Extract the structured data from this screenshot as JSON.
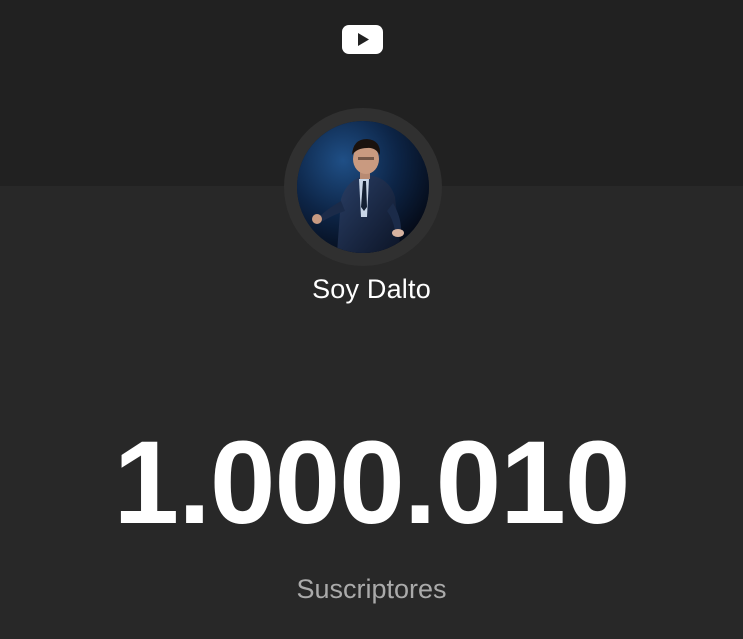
{
  "header": {
    "logo_icon": "youtube-play-icon",
    "logo_color": "#ffffff"
  },
  "channel": {
    "avatar_icon": "channel-avatar",
    "name": "Soy Dalto"
  },
  "stats": {
    "subscriber_count": "1.000.010",
    "subscriber_label": "Suscriptores"
  },
  "colors": {
    "background": "#282828",
    "top_band": "#212121",
    "avatar_ring": "#303030",
    "text_primary": "#ffffff",
    "text_secondary": "#aaaaaa"
  }
}
